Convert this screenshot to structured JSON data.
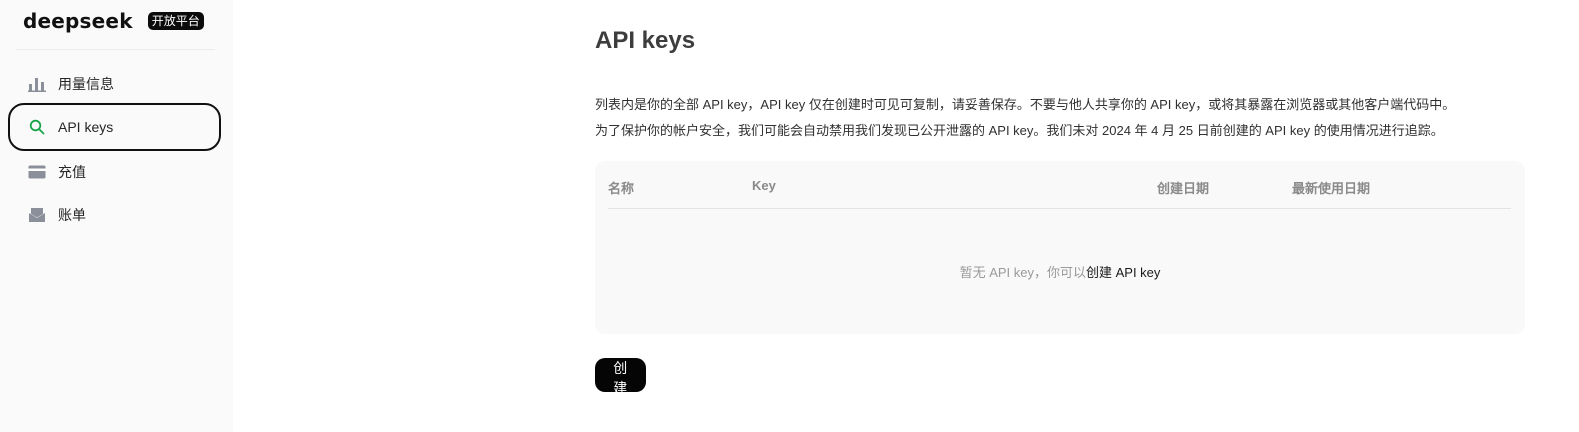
{
  "brand": {
    "name": "deepseek",
    "badge": "开放平台"
  },
  "sidebar": {
    "items": [
      {
        "label": "用量信息",
        "icon": "bar-chart-icon",
        "active": false
      },
      {
        "label": "API keys",
        "icon": "search-icon",
        "active": true
      },
      {
        "label": "充值",
        "icon": "credit-card-icon",
        "active": false
      },
      {
        "label": "账单",
        "icon": "inbox-icon",
        "active": false
      }
    ]
  },
  "main": {
    "title": "API keys",
    "description_line1": "列表内是你的全部 API key，API key 仅在创建时可见可复制，请妥善保存。不要与他人共享你的 API key，或将其暴露在浏览器或其他客户端代码中。",
    "description_line2": "为了保护你的帐户安全，我们可能会自动禁用我们发现已公开泄露的 API key。我们未对 2024 年 4 月 25 日前创建的 API key 的使用情况进行追踪。",
    "table": {
      "columns": [
        "名称",
        "Key",
        "创建日期",
        "最新使用日期"
      ],
      "empty_text": "暂无 API key，你可以",
      "empty_link": "创建 API key"
    },
    "create_button": "创建 API key"
  },
  "colors": {
    "active_icon": "#16a34a",
    "nav_icon": "#8a8f99",
    "button_bg": "#050505"
  }
}
